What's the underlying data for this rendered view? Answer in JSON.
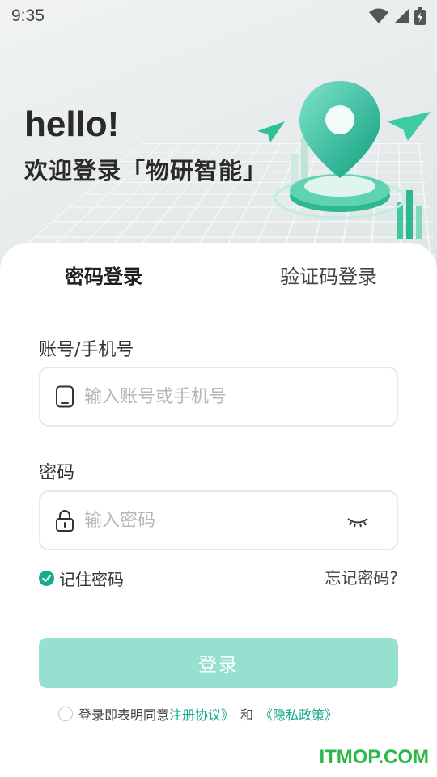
{
  "status_bar": {
    "time": "9:35"
  },
  "hero": {
    "greeting": "hello!",
    "welcome": "欢迎登录「物研智能」"
  },
  "tabs": [
    {
      "label": "密码登录",
      "active": true
    },
    {
      "label": "验证码登录",
      "active": false
    }
  ],
  "account_field": {
    "label": "账号/手机号",
    "placeholder": "输入账号或手机号",
    "value": ""
  },
  "password_field": {
    "label": "密码",
    "placeholder": "输入密码",
    "value": ""
  },
  "remember": {
    "label": "记住密码",
    "checked": true
  },
  "forgot_label": "忘记密码?",
  "login_button": "登录",
  "agreement": {
    "prefix": "登录即表明同意",
    "user_agreement": "注册协议》",
    "and": "和",
    "privacy_policy": "《隐私政策》"
  },
  "watermark": "ITMOP.COM",
  "colors": {
    "accent": "#16a98a",
    "button": "#96e0cf"
  }
}
